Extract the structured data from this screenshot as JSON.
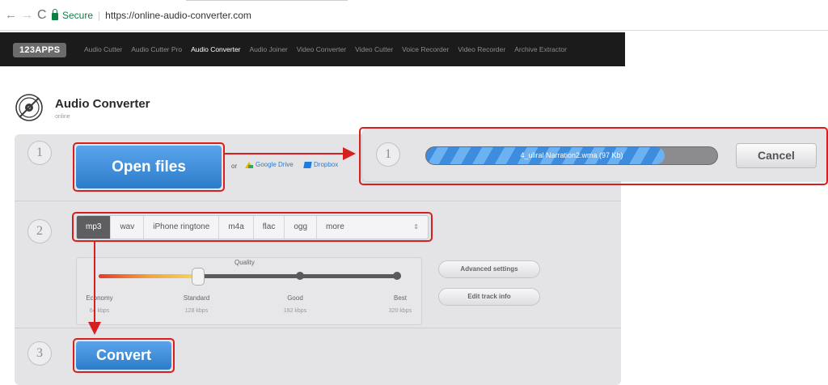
{
  "browser": {
    "back_glyph": "←",
    "forward_glyph": "→",
    "reload_glyph": "C",
    "secure_label": "Secure",
    "separator": "|",
    "url": "https://online-audio-converter.com"
  },
  "site_nav": {
    "logo": "123APPS",
    "items": [
      "Audio Cutter",
      "Audio Cutter Pro",
      "Audio Converter",
      "Audio Joiner",
      "Video Converter",
      "Video Cutter",
      "Voice Recorder",
      "Video Recorder",
      "Archive Extractor"
    ],
    "active_index": 2
  },
  "app": {
    "title": "Audio Converter",
    "subtitle": "online",
    "icon": "disc-icon"
  },
  "step1": {
    "number": "1",
    "open_button": "Open files",
    "or_label": "or",
    "google_drive": "Google Drive",
    "dropbox": "Dropbox"
  },
  "step2": {
    "number": "2",
    "formats": [
      "mp3",
      "wav",
      "iPhone ringtone",
      "m4a",
      "flac",
      "ogg",
      "more"
    ],
    "selected_format": "mp3",
    "more_glyph": "⇕",
    "quality": {
      "label": "Quality",
      "levels": [
        {
          "name": "Economy",
          "rate": "64 kbps"
        },
        {
          "name": "Standard",
          "rate": "128 kbps"
        },
        {
          "name": "Good",
          "rate": "192 kbps"
        },
        {
          "name": "Best",
          "rate": "320 kbps"
        }
      ],
      "selected_level": "Standard",
      "slider_value_fraction": 0.33
    },
    "advanced_settings": "Advanced settings",
    "edit_track_info": "Edit track info"
  },
  "step3": {
    "number": "3",
    "convert_button": "Convert"
  },
  "upload": {
    "number": "1",
    "file_label": "4_uliral Narration2.wma (97 Kb)",
    "progress_fraction": 0.82,
    "cancel_button": "Cancel"
  },
  "colors": {
    "highlight": "#d5201f",
    "primary_button": "#2d7cc9",
    "secure_green": "#0b8043",
    "nav_bg": "#1b1b1b"
  }
}
